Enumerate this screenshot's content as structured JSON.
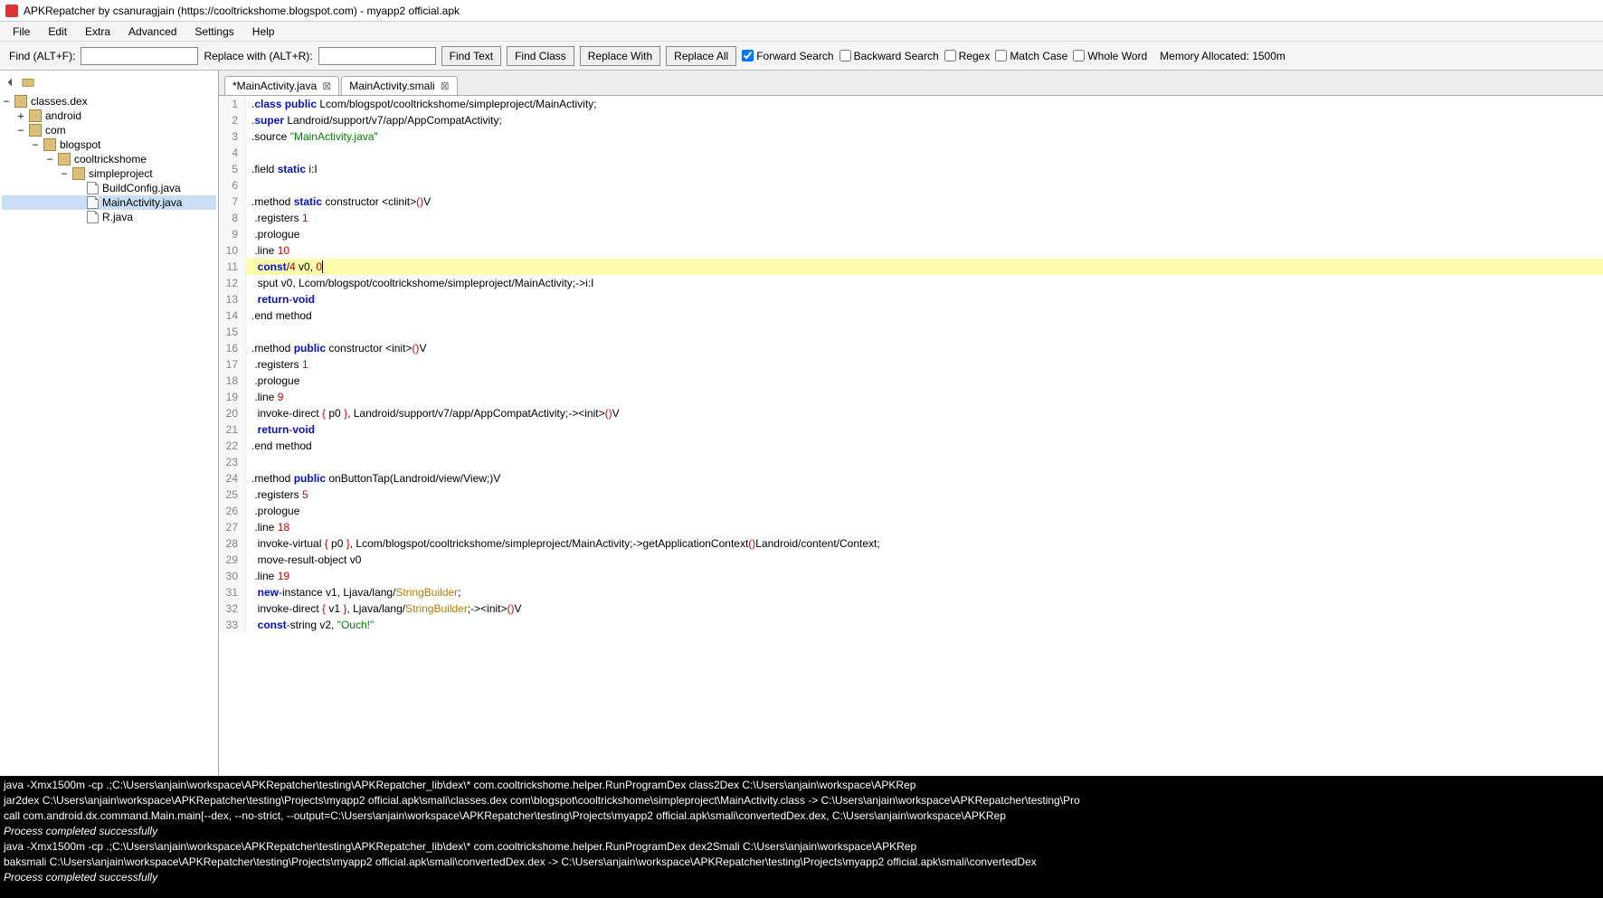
{
  "title": "APKRepatcher by csanuragjain (https://cooltrickshome.blogspot.com) - myapp2 official.apk",
  "menu": [
    "File",
    "Edit",
    "Extra",
    "Advanced",
    "Settings",
    "Help"
  ],
  "tb": {
    "find_lbl": "Find (ALT+F):",
    "replace_lbl": "Replace with (ALT+R):",
    "find_text": "Find Text",
    "find_class": "Find Class",
    "replace_with": "Replace With",
    "replace_all": "Replace All",
    "forward": "Forward Search",
    "backward": "Backward Search",
    "regex": "Regex",
    "match": "Match Case",
    "whole": "Whole Word",
    "mem": "Memory Allocated: 1500m"
  },
  "tree": {
    "root": "classes.dex",
    "n1": "android",
    "n2": "com",
    "n3": "blogspot",
    "n4": "cooltrickshome",
    "n5": "simpleproject",
    "f1": "BuildConfig.java",
    "f2": "MainActivity.java",
    "f3": "R.java"
  },
  "tabs": {
    "t1": "*MainActivity.java",
    "t2": "MainActivity.smali"
  },
  "console": [
    "java -Xmx1500m -cp .;C:\\Users\\anjain\\workspace\\APKRepatcher\\testing\\APKRepatcher_lib\\dex\\* com.cooltrickshome.helper.RunProgramDex class2Dex C:\\Users\\anjain\\workspace\\APKRep",
    "jar2dex C:\\Users\\anjain\\workspace\\APKRepatcher\\testing\\Projects\\myapp2 official.apk\\smali\\classes.dex com\\blogspot\\cooltrickshome\\simpleproject\\MainActivity.class -> C:\\Users\\anjain\\workspace\\APKRepatcher\\testing\\Pro",
    "call com.android.dx.command.Main.main[--dex, --no-strict, --output=C:\\Users\\anjain\\workspace\\APKRepatcher\\testing\\Projects\\myapp2 official.apk\\smali\\convertedDex.dex, C:\\Users\\anjain\\workspace\\APKRep",
    "Process completed successfully",
    "java -Xmx1500m -cp .;C:\\Users\\anjain\\workspace\\APKRepatcher\\testing\\APKRepatcher_lib\\dex\\* com.cooltrickshome.helper.RunProgramDex dex2Smali C:\\Users\\anjain\\workspace\\APKRep",
    "baksmali C:\\Users\\anjain\\workspace\\APKRepatcher\\testing\\Projects\\myapp2 official.apk\\smali\\convertedDex.dex -> C:\\Users\\anjain\\workspace\\APKRepatcher\\testing\\Projects\\myapp2 official.apk\\smali\\convertedDex",
    "Process completed successfully"
  ]
}
